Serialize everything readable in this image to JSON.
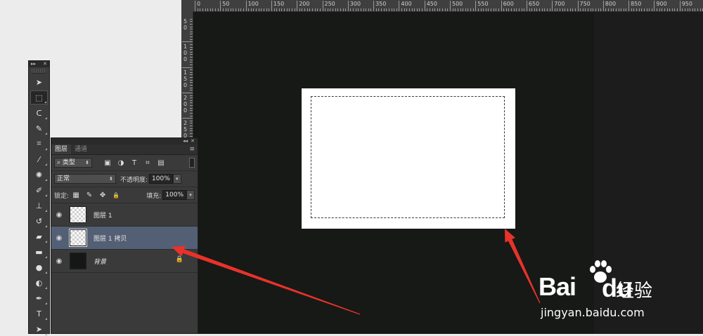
{
  "ruler": {
    "h_labels": [
      "0",
      "50",
      "100",
      "150",
      "200",
      "250",
      "300",
      "350",
      "400",
      "450",
      "500",
      "550",
      "600",
      "650",
      "700",
      "750",
      "800",
      "850",
      "900",
      "950"
    ],
    "v_labels": [
      "50",
      "100",
      "150",
      "200",
      "250"
    ]
  },
  "tools_panel": {
    "collapse_glyph": "▸▸",
    "close_glyph": "✕",
    "tools": [
      {
        "name": "move-tool",
        "glyph": "➤"
      },
      {
        "name": "rect-marquee-tool",
        "glyph": "⬚"
      },
      {
        "name": "lasso-tool",
        "glyph": "ᑕ"
      },
      {
        "name": "quick-selection-tool",
        "glyph": "✎"
      },
      {
        "name": "crop-tool",
        "glyph": "⌗"
      },
      {
        "name": "eyedropper-tool",
        "glyph": "⁄"
      },
      {
        "name": "healing-brush-tool",
        "glyph": "✺"
      },
      {
        "name": "brush-tool",
        "glyph": "✐"
      },
      {
        "name": "clone-stamp-tool",
        "glyph": "⊥"
      },
      {
        "name": "history-brush-tool",
        "glyph": "↺"
      },
      {
        "name": "eraser-tool",
        "glyph": "▰"
      },
      {
        "name": "gradient-tool",
        "glyph": "▬"
      },
      {
        "name": "blur-tool",
        "glyph": "●"
      },
      {
        "name": "dodge-tool",
        "glyph": "◐"
      },
      {
        "name": "pen-tool",
        "glyph": "✒"
      },
      {
        "name": "type-tool",
        "glyph": "T"
      },
      {
        "name": "path-selection-tool",
        "glyph": "➤"
      }
    ]
  },
  "layers_panel": {
    "collapse_glyph": "◂◂",
    "close_glyph": "✕",
    "menu_glyph": "≡",
    "tabs": [
      {
        "label": "图层",
        "active": true
      },
      {
        "label": "通道",
        "active": false
      }
    ],
    "filter": {
      "search_glyph": "⌕",
      "kind_label": "类型",
      "icons": [
        "▣",
        "◑",
        "T",
        "⌗",
        "▤"
      ]
    },
    "blend_mode": "正常",
    "opacity_label": "不透明度:",
    "opacity_value": "100%",
    "lock_label": "锁定:",
    "lock_icons": [
      "▦",
      "✎",
      "✥",
      "🔒"
    ],
    "fill_label": "填充:",
    "fill_value": "100%",
    "layers": [
      {
        "name": "图层 1",
        "selected": false,
        "thumb": "checker",
        "locked": false,
        "italic": false
      },
      {
        "name": "图层 1 拷贝",
        "selected": true,
        "thumb": "checker",
        "locked": false,
        "italic": false
      },
      {
        "name": "背景",
        "selected": false,
        "thumb": "dark",
        "locked": true,
        "italic": true
      }
    ],
    "eye_glyph": "◉",
    "lock_glyph": "🔒"
  },
  "watermark": {
    "brand_bai": "Bai",
    "brand_du": "du",
    "brand_cn": "经验",
    "url": "jingyan.baidu.com"
  },
  "colors": {
    "annotation_arrow": "#e8322b",
    "selected_layer": "#535f74",
    "canvas_bg": "#161916"
  }
}
